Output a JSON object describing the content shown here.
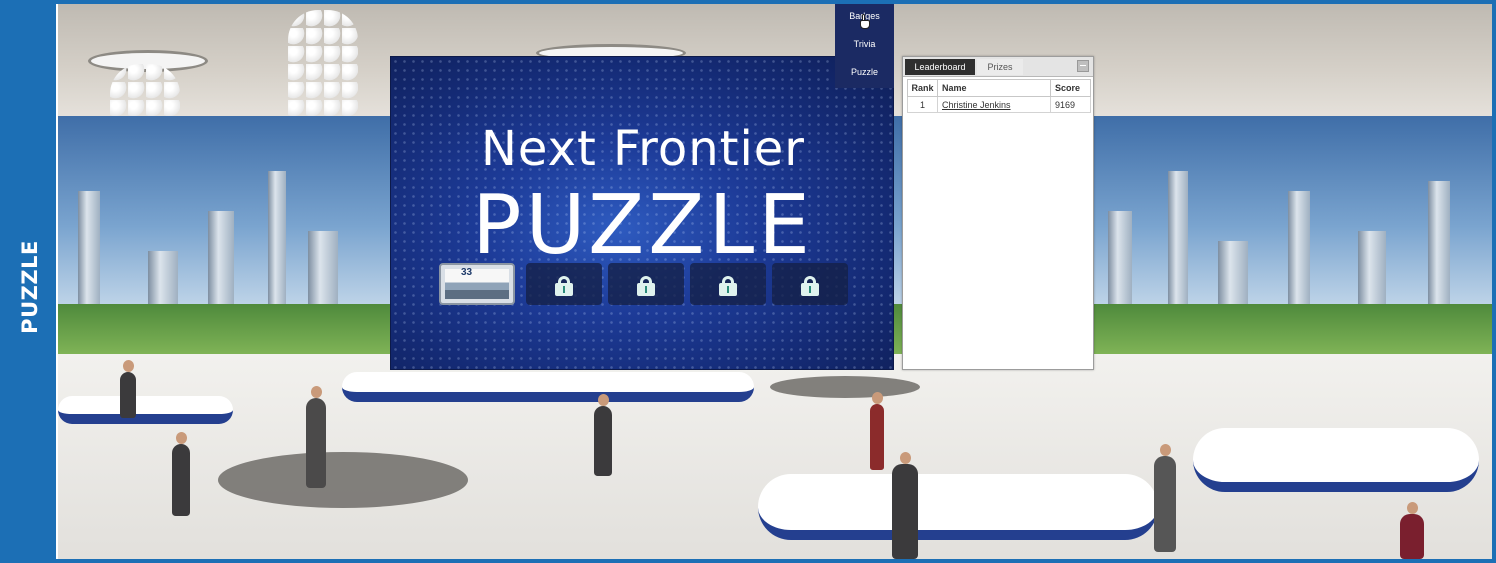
{
  "side_tab": {
    "label": "PUZZLE"
  },
  "puzzle": {
    "title_top": "Next Frontier",
    "title_big": "PUZZLE",
    "first_piece_number": "33",
    "pieces": [
      {
        "state": "unlocked"
      },
      {
        "state": "locked"
      },
      {
        "state": "locked"
      },
      {
        "state": "locked"
      },
      {
        "state": "locked"
      }
    ]
  },
  "menu": {
    "items": [
      "Badges",
      "Trivia",
      "Puzzle"
    ]
  },
  "leaderboard": {
    "tabs": [
      "Leaderboard",
      "Prizes"
    ],
    "active_tab": "Leaderboard",
    "columns": [
      "Rank",
      "Name",
      "Score"
    ],
    "rows": [
      {
        "rank": "1",
        "name": "Christine Jenkins",
        "score": "9169"
      }
    ]
  },
  "colors": {
    "frame": "#1c6fb5",
    "menu_bg": "#1b2a63",
    "card_bg": "#1d3b98",
    "lock": "#dff2ee"
  }
}
